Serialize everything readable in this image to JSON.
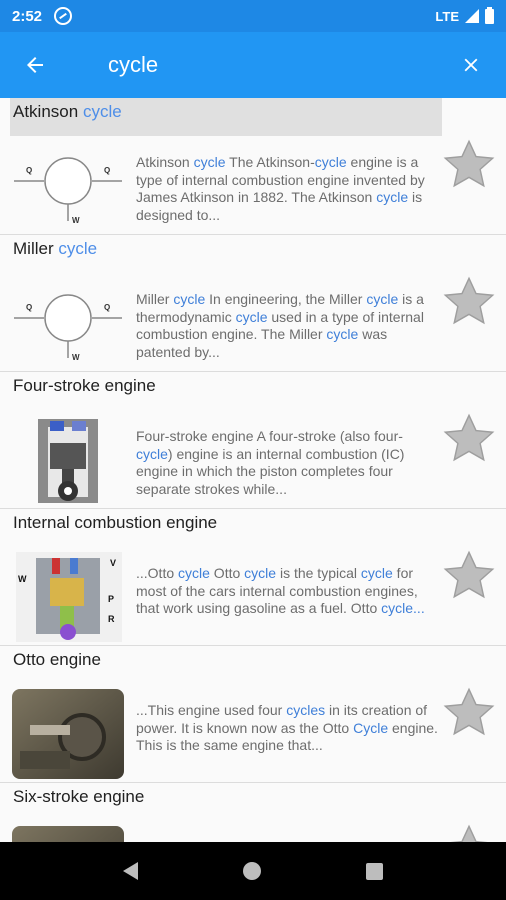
{
  "status_bar": {
    "time": "2:52",
    "network": "LTE"
  },
  "search": {
    "query": "cycle"
  },
  "results": [
    {
      "title_pre": "Atkinson ",
      "title_hl": "cycle",
      "title_post": "",
      "snippet": [
        [
          "Atkinson ",
          false
        ],
        [
          "cycle",
          true
        ],
        [
          " The Atkinson-",
          false
        ],
        [
          "cycle",
          true
        ],
        [
          " engine is a type of internal combustion engine invented by James Atkinson in 1882. The Atkinson ",
          false
        ],
        [
          "cycle",
          true
        ],
        [
          " is designed to...",
          false
        ]
      ],
      "thumb_icon": "thermodynamic-diagram"
    },
    {
      "title_pre": "Miller ",
      "title_hl": "cycle",
      "title_post": "",
      "snippet": [
        [
          "Miller ",
          false
        ],
        [
          "cycle",
          true
        ],
        [
          " In engineering, the Miller ",
          false
        ],
        [
          "cycle",
          true
        ],
        [
          " is a thermodynamic ",
          false
        ],
        [
          "cycle",
          true
        ],
        [
          " used in a type of internal combustion engine. The Miller ",
          false
        ],
        [
          "cycle",
          true
        ],
        [
          " was patented by...",
          false
        ]
      ],
      "thumb_icon": "thermodynamic-diagram"
    },
    {
      "title_pre": "Four-stroke engine",
      "title_hl": "",
      "title_post": "",
      "snippet": [
        [
          "Four-stroke engine A four-stroke (also four-",
          false
        ],
        [
          "cycle",
          true
        ],
        [
          ") engine is an internal combustion (IC) engine in which the piston completes four separate strokes while...",
          false
        ]
      ],
      "thumb_icon": "piston-cutaway"
    },
    {
      "title_pre": "Internal combustion engine",
      "title_hl": "",
      "title_post": "",
      "snippet": [
        [
          "...Otto ",
          false
        ],
        [
          "cycle",
          true
        ],
        [
          " Otto ",
          false
        ],
        [
          "cycle",
          true
        ],
        [
          " is the typical ",
          false
        ],
        [
          "cycle",
          true
        ],
        [
          " for most of the cars internal combustion engines, that work using gasoline as a fuel. Otto ",
          false
        ],
        [
          "cycle...",
          true
        ]
      ],
      "thumb_icon": "engine-diagram",
      "thumb_labels": {
        "w": "W",
        "v": "V",
        "p": "P",
        "r": "R"
      }
    },
    {
      "title_pre": "Otto engine",
      "title_hl": "",
      "title_post": "",
      "snippet": [
        [
          "...This engine used four ",
          false
        ],
        [
          "cycles",
          true
        ],
        [
          " in its creation of power. It is known now as the Otto ",
          false
        ],
        [
          "Cycle",
          true
        ],
        [
          " engine. This is the same engine that...",
          false
        ]
      ],
      "thumb_icon": "engine-photo"
    },
    {
      "title_pre": "Six-stroke engine",
      "title_hl": "",
      "title_post": "",
      "snippet": [],
      "thumb_icon": "engine-photo"
    }
  ],
  "diagram_labels": {
    "q1": "Q",
    "q2": "Q",
    "w": "W"
  },
  "colors": {
    "app_bar": "#2196f3",
    "status_bar": "#1e88e5",
    "highlight": "#3f7fd8",
    "star": "#bdbdbd"
  }
}
